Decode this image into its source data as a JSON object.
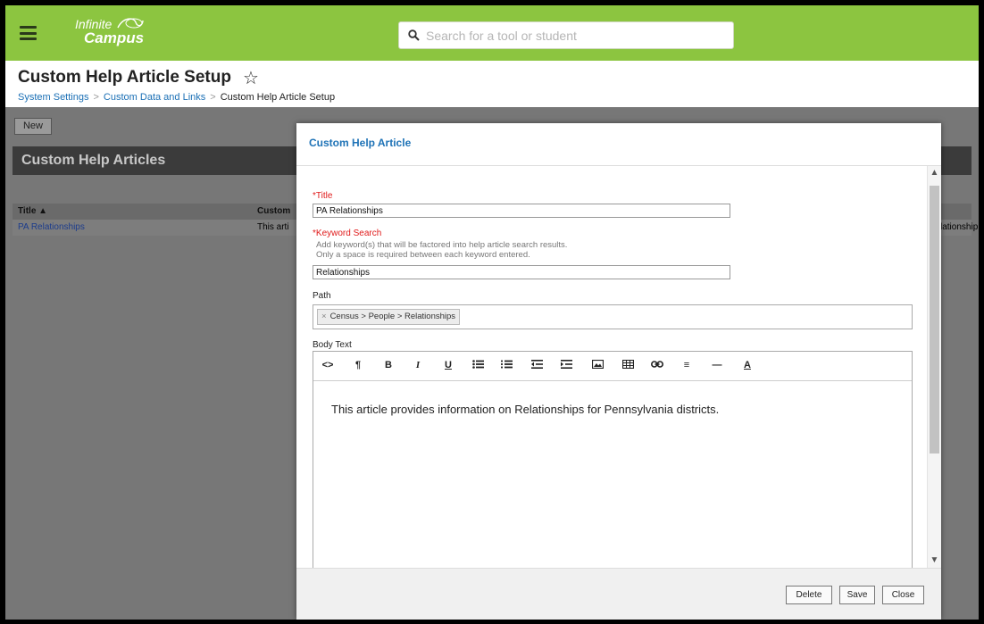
{
  "app": {
    "logo_line1": "Infinite",
    "logo_line2": "Campus",
    "search_placeholder": "Search for a tool or student"
  },
  "page": {
    "title": "Custom Help Article Setup",
    "breadcrumb": [
      "System Settings",
      "Custom Data and Links",
      "Custom Help Article Setup"
    ]
  },
  "background": {
    "new_button": "New",
    "panel_title": "Custom Help Articles",
    "columns": [
      "Title ▲",
      "Custom"
    ],
    "row": {
      "title": "PA Relationships",
      "desc": "This arti",
      "right": "lationship"
    }
  },
  "modal": {
    "title": "Custom Help Article",
    "title_label": "Title",
    "title_value": "PA Relationships",
    "keyword_label": "Keyword Search",
    "keyword_help1": "Add keyword(s) that will be factored into help article search results.",
    "keyword_help2": "Only a space is required between each keyword entered.",
    "keyword_value": "Relationships",
    "path_label": "Path",
    "path_chip": "Census > People > Relationships",
    "body_label": "Body Text",
    "body_content": "This article provides information on Relationships for Pennsylvania districts.",
    "toolbar": {
      "code": "<>",
      "paragraph": "¶",
      "bold": "B",
      "italic": "I",
      "underline": "U",
      "align": "≡",
      "hr": "—",
      "font_color": "A"
    },
    "buttons": {
      "delete": "Delete",
      "save": "Save",
      "close": "Close"
    }
  },
  "colors": {
    "header_green": "#8cc540",
    "link_blue": "#1a6fb5",
    "required_red": "#e01a1a"
  }
}
